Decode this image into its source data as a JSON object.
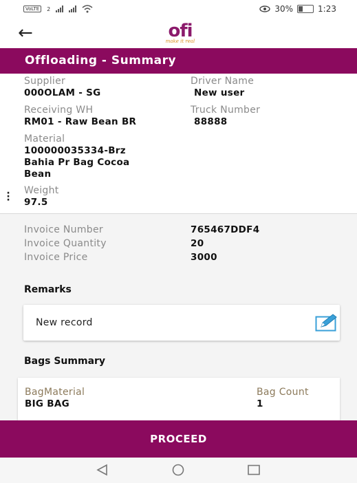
{
  "status_bar": {
    "left_badges": [
      "VoLTE",
      "2"
    ],
    "battery_percent": "30%",
    "time": "1:23",
    "icons": [
      "signal-icon",
      "wifi-icon",
      "eye-icon",
      "battery-icon"
    ]
  },
  "app_bar": {
    "back_icon": "arrow-left-icon",
    "logo_text": "ofi",
    "logo_tagline": "make it real"
  },
  "title": "Offloading - Summary",
  "details": {
    "supplier_label": "Supplier",
    "supplier_value": "000OLAM - SG",
    "driver_label": "Driver Name",
    "driver_value": "New user",
    "receiving_label": "Receiving WH",
    "receiving_value": "RM01 - Raw Bean BR",
    "truck_label": "Truck Number",
    "truck_value": "88888",
    "material_label": "Material",
    "material_value_lines": [
      "100000035334-Brz",
      "Bahia Pr Bag Cocoa",
      "Bean"
    ],
    "weight_label": "Weight",
    "weight_value": "97.5"
  },
  "invoice": {
    "number_label": "Invoice Number",
    "number_value": "765467DDF4",
    "quantity_label": "Invoice Quantity",
    "quantity_value": "20",
    "price_label": "Invoice Price",
    "price_value": "3000"
  },
  "remarks": {
    "title": "Remarks",
    "value": "New record",
    "edit_icon": "edit-icon"
  },
  "bags": {
    "title": "Bags Summary",
    "col_material": "BagMaterial",
    "col_count": "Bag Count",
    "rows": [
      {
        "material": "BIG BAG",
        "count": "1"
      }
    ]
  },
  "proceed_label": "PROCEED",
  "colors": {
    "brand": "#8b0a5e",
    "logo_accent": "#d9901f",
    "edit_icon": "#3aa0d8"
  }
}
